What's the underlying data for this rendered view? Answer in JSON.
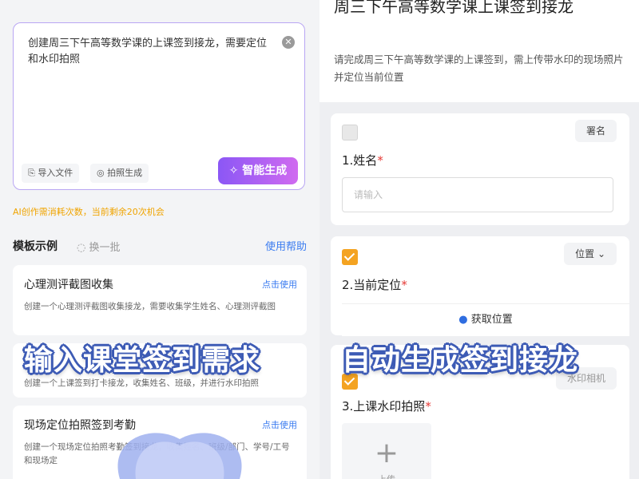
{
  "left": {
    "ai_input": {
      "text": "创建周三下午高等数学课的上课签到接龙，需要定位和水印拍照",
      "clear_icon": "close-circle-icon",
      "import_file_label": "导入文件",
      "photo_generate_label": "拍照生成",
      "generate_label": "智能生成"
    },
    "ai_tip": "AI创作需消耗次数，当前剩余20次机会",
    "templates": {
      "title": "模板示例",
      "swap_label": "换一批",
      "help_label": "使用帮助",
      "items": [
        {
          "name": "心理测评截图收集",
          "use_label": "点击使用",
          "desc": "创建一个心理测评截图收集接龙，需要收集学生姓名、心理测评截图"
        },
        {
          "name": "上",
          "use_label": "",
          "desc": "创建一个上课签到打卡接龙，收集姓名、班级，并进行水印拍照"
        },
        {
          "name": "现场定位拍照签到考勤",
          "use_label": "点击使用",
          "desc": "创建一个现场定位拍照考勤签到接龙，收集姓名、班级/部门、学号/工号和现场定"
        }
      ]
    }
  },
  "right": {
    "title": "周三下午高等数学课上课签到接龙",
    "subtitle": "请完成周三下午高等数学课的上课签到，需上传带水印的现场照片并定位当前位置",
    "fields": [
      {
        "tag": "署名",
        "label": "1.姓名",
        "required": "*",
        "placeholder": "请输入"
      },
      {
        "tag": "位置",
        "label": "2.当前定位",
        "required": "*",
        "button": "获取位置"
      },
      {
        "tag": "水印相机",
        "label": "3.上课水印拍照",
        "required": "*",
        "upload_hint": "上传"
      }
    ]
  },
  "overlay": {
    "left_caption": "输入课堂签到需求",
    "right_caption": "自动生成签到接龙"
  },
  "colors": {
    "accent_purple": "#8b57f5",
    "link_blue": "#3b7cf0",
    "checkbox_orange": "#f4a321",
    "tip_orange": "#f0a400"
  }
}
